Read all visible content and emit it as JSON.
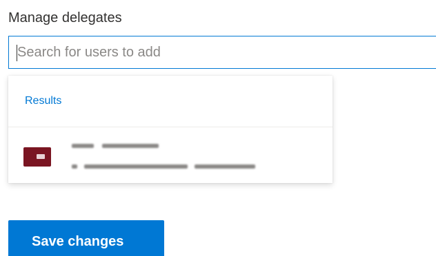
{
  "section": {
    "title": "Manage delegates"
  },
  "search": {
    "placeholder": "Search for users to add",
    "value": ""
  },
  "results": {
    "header": "Results",
    "items": [
      {
        "display_name": "(redacted)",
        "email": "(redacted)",
        "avatar_color": "#7a1522"
      }
    ]
  },
  "actions": {
    "save_label": "Save changes"
  },
  "colors": {
    "accent": "#0078d4",
    "text": "#323130",
    "placeholder": "#8a8886",
    "divider": "#edebe9"
  }
}
